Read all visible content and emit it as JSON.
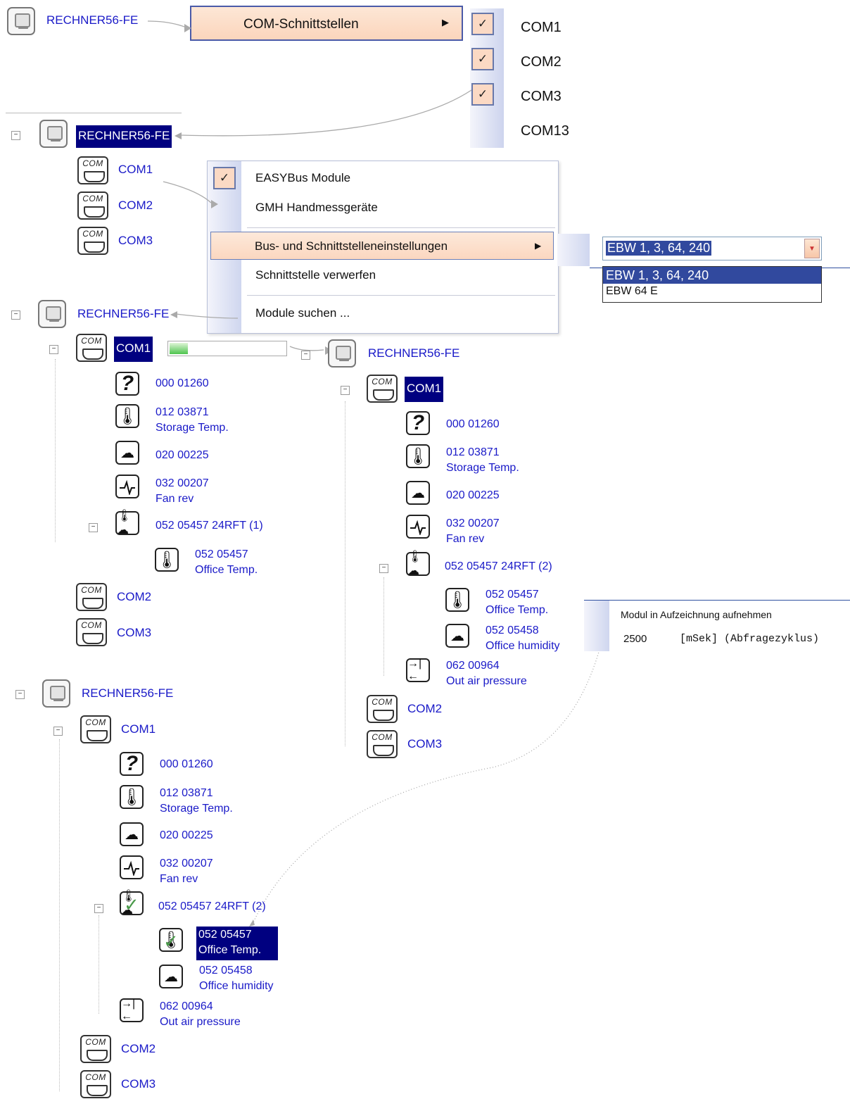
{
  "computer_name": "RECHNER56-FE",
  "com_icon_label": "COM",
  "menu1": {
    "item": "COM-Schnittstellen",
    "ports": [
      "COM1",
      "COM2",
      "COM3",
      "COM13"
    ]
  },
  "context_menu": {
    "easybus": "EASYBus Module",
    "gmh": "GMH Handmessgeräte",
    "bus": "Bus- und Schnittstelleneinstellungen",
    "discard": "Schnittstelle verwerfen",
    "search": "Module suchen ..."
  },
  "combo": {
    "value": "EBW 1, 3, 64, 240",
    "options": [
      "EBW 1, 3, 64, 240",
      "EBW 64 E"
    ]
  },
  "ports": {
    "com1": "COM1",
    "com2": "COM2",
    "com3": "COM3"
  },
  "modules": {
    "m000": "000 01260",
    "m012_id": "012 03871",
    "m012_name": "Storage Temp.",
    "m020": "020 00225",
    "m032_id": "032 00207",
    "m032_name": "Fan rev",
    "group1": "052 05457  24RFT (1)",
    "group2": "052 05457  24RFT (2)",
    "m052a_id": "052 05457",
    "m052a_name": "Office Temp.",
    "m052b_id": "052 05458",
    "m052b_name": "Office humidity",
    "m062_id": "062 00964",
    "m062_name": "Out air pressure"
  },
  "record_menu": {
    "item": "Modul in Aufzeichnung aufnehmen",
    "value": "2500",
    "unit": "[mSek] (Abfragezyklus)"
  },
  "colors": {
    "link": "#1a1ac8",
    "selection": "#000080",
    "menu_highlight": "#fbd7c0"
  }
}
